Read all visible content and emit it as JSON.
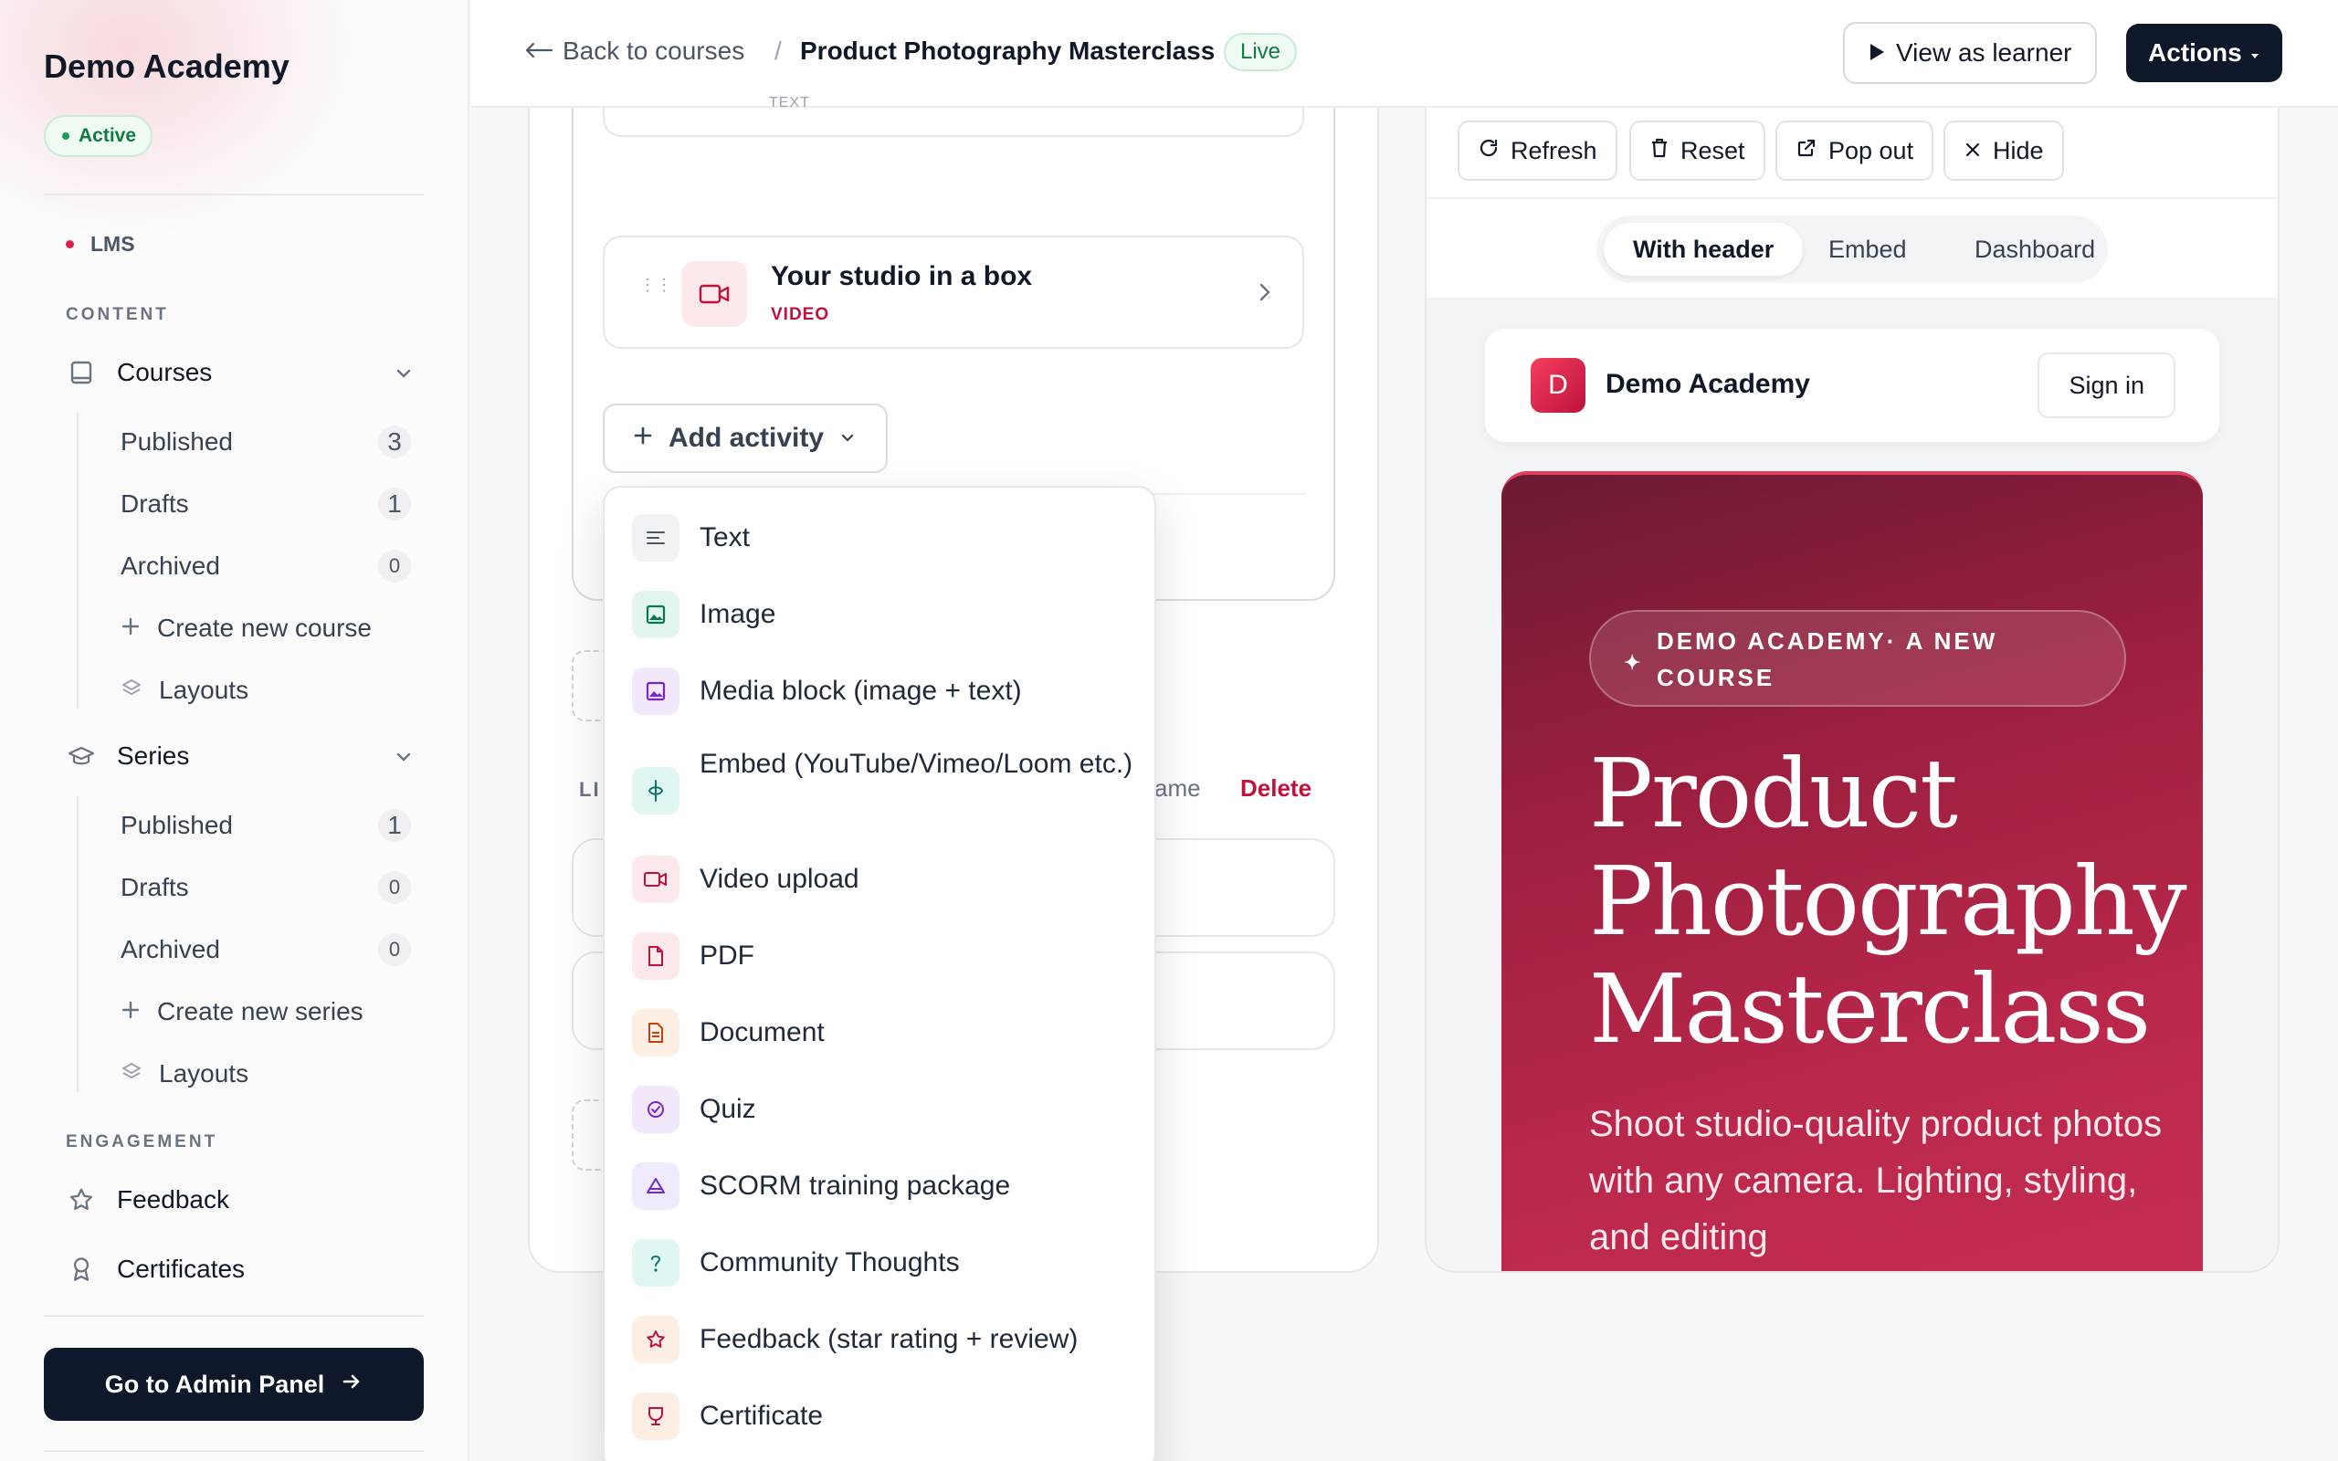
{
  "sidebar": {
    "brand": "Demo Academy",
    "status": "Active",
    "lms_label": "LMS",
    "content_label": "CONTENT",
    "courses": {
      "label": "Courses",
      "children": [
        {
          "label": "Published",
          "count": "3"
        },
        {
          "label": "Drafts",
          "count": "1"
        },
        {
          "label": "Archived",
          "count": "0"
        }
      ],
      "create": "Create new course",
      "layouts": "Layouts"
    },
    "series": {
      "label": "Series",
      "children": [
        {
          "label": "Published",
          "count": "1"
        },
        {
          "label": "Drafts",
          "count": "0"
        },
        {
          "label": "Archived",
          "count": "0"
        }
      ],
      "create": "Create new series",
      "layouts": "Layouts"
    },
    "engagement_label": "ENGAGEMENT",
    "feedback": "Feedback",
    "certificates": "Certificates",
    "admin_button": "Go to Admin Panel"
  },
  "topbar": {
    "back": "Back to courses",
    "separator": "/",
    "course_title": "Product Photography Masterclass",
    "status": "Live",
    "view_as_learner": "View as learner",
    "actions": "Actions"
  },
  "editor": {
    "stub_type": "TEXT",
    "activity": {
      "title": "Your studio in a box",
      "type": "VIDEO"
    },
    "add_activity": "Add activity",
    "partial_label": "LI",
    "rename": "ame",
    "delete": "Delete"
  },
  "menu": {
    "items": [
      {
        "label": "Text",
        "icon": "text-lines-icon"
      },
      {
        "label": "Image",
        "icon": "image-icon"
      },
      {
        "label": "Media block (image + text)",
        "icon": "media-block-icon"
      },
      {
        "label": "Embed (YouTube/Vimeo/Loom etc.)",
        "icon": "embed-icon"
      },
      {
        "label": "Video upload",
        "icon": "video-icon"
      },
      {
        "label": "PDF",
        "icon": "pdf-icon"
      },
      {
        "label": "Document",
        "icon": "document-icon"
      },
      {
        "label": "Quiz",
        "icon": "quiz-icon"
      },
      {
        "label": "SCORM training package",
        "icon": "scorm-icon"
      },
      {
        "label": "Community Thoughts",
        "icon": "community-icon"
      },
      {
        "label": "Feedback (star rating + review)",
        "icon": "star-icon"
      },
      {
        "label": "Certificate",
        "icon": "certificate-icon"
      }
    ]
  },
  "preview": {
    "toolbar": {
      "refresh": "Refresh",
      "reset": "Reset",
      "popout": "Pop out",
      "hide": "Hide"
    },
    "tabs": [
      "With header",
      "Embed",
      "Dashboard"
    ],
    "active_tab": "With header",
    "site": {
      "logo_letter": "D",
      "name": "Demo Academy",
      "signin": "Sign in"
    },
    "hero": {
      "eyebrow": "DEMO ACADEMY· A NEW COURSE",
      "title": "Product Photography Masterclass",
      "subtitle": "Shoot studio-quality product photos with any camera. Lighting, styling, and editing"
    }
  },
  "colors": {
    "accent": "#be123c",
    "dark": "#0f172a",
    "success": "#137a45"
  }
}
